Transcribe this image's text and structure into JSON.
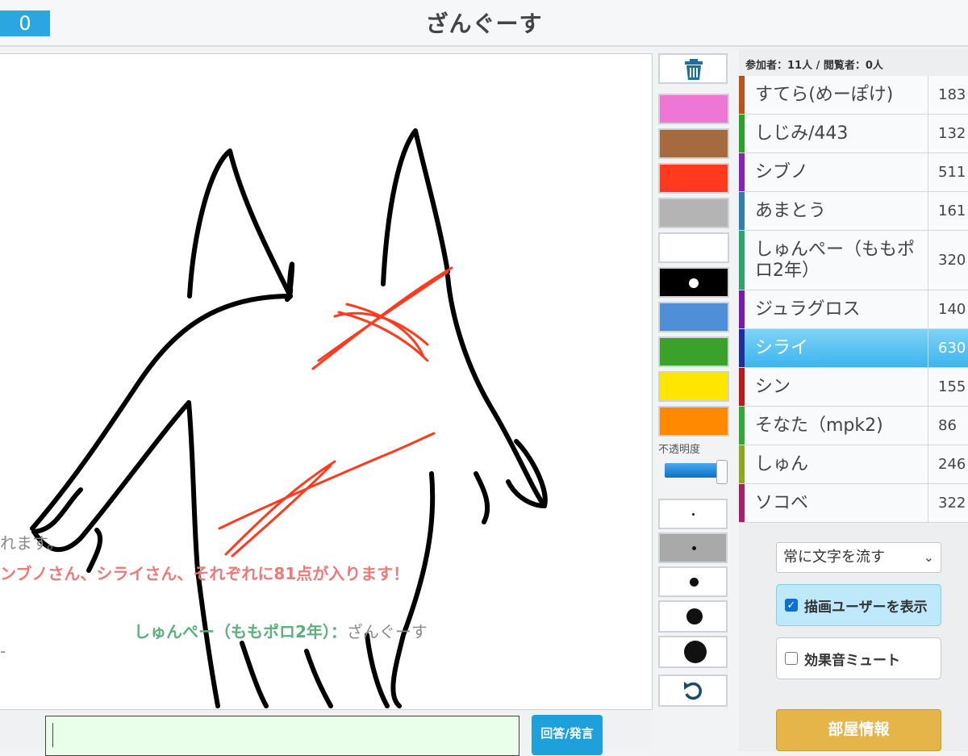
{
  "header": {
    "timer": "0",
    "answer": "ざんぐーす"
  },
  "canvas_overlay": {
    "line1": "れます。",
    "line2": "ンブノさん、シライさん、それぞれに81点が入ります！",
    "chat_user": "しゅんぺー（ももポロ2年）：",
    "chat_text": "ざんぐーす",
    "dash": "-"
  },
  "tools": {
    "trash_icon": "trash-icon",
    "colors": [
      "#ee77d6",
      "#a56b3f",
      "#ff3a1e",
      "#b4b4b4",
      "#ffffff",
      "#000000",
      "#4e8fd8",
      "#3aa12a",
      "#ffe600",
      "#ff8a00"
    ],
    "opacity_label": "不透明度",
    "opacity_value": 0.85,
    "undo_icon": "undo-icon"
  },
  "panel": {
    "counts": "参加者：11人 / 閲覧者：0人",
    "users": [
      {
        "name": "すてら(めーぽけ)",
        "score": "183",
        "color": "#b5541b"
      },
      {
        "name": "しじみ/443",
        "score": "132",
        "color": "#2aa12a"
      },
      {
        "name": "シブノ",
        "score": "511",
        "color": "#8a22b3"
      },
      {
        "name": "あまとう",
        "score": "161",
        "color": "#2c7fae"
      },
      {
        "name": "しゅんぺー（ももポロ2年）",
        "score": "320",
        "color": "#2fa36e"
      },
      {
        "name": "ジュラグロス",
        "score": "140",
        "color": "#7a1aa8"
      },
      {
        "name": "シライ",
        "score": "630",
        "color": "#1f2f9a",
        "active": true
      },
      {
        "name": "シン",
        "score": "155",
        "color": "#b81d1d"
      },
      {
        "name": "そなた（mpk2)",
        "score": "86",
        "color": "#30a83a"
      },
      {
        "name": "しゅん",
        "score": "246",
        "color": "#8fa51d"
      },
      {
        "name": "ソコベ",
        "score": "322",
        "color": "#a5226a"
      }
    ],
    "flow_select": "常に文字を流す",
    "show_drawer": {
      "label": "描画ユーザーを表示",
      "checked": true
    },
    "mute_sound": {
      "label": "効果音ミュート",
      "checked": false
    },
    "room_info": "部屋情報"
  },
  "chat": {
    "send_label": "回答/発言",
    "input_value": ""
  }
}
